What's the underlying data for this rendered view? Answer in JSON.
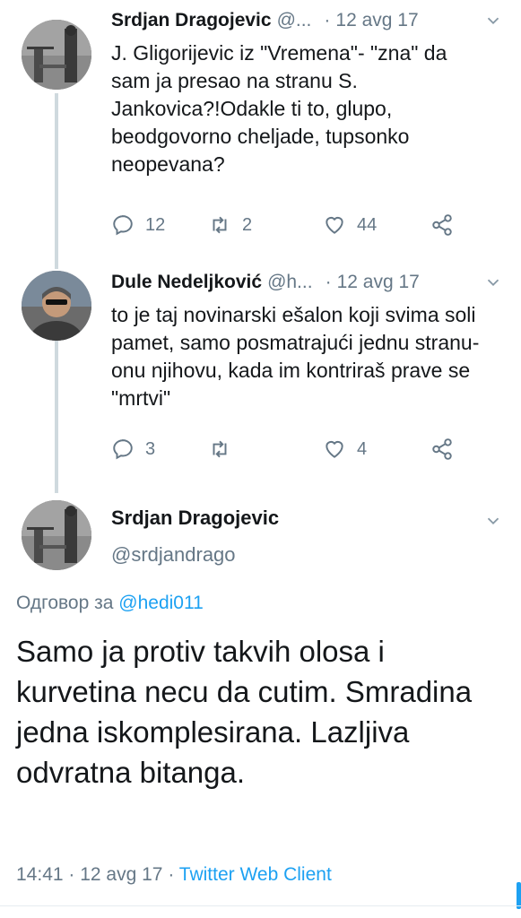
{
  "tweets": [
    {
      "name": "Srdjan Dragojevic",
      "handle": "@...",
      "time": "12 avg 17",
      "text": "J. Gligorijevic iz \"Vremena\"- \"zna\" da sam ja presao na stranu S. Jankovica?!Odakle ti to, glupo, beodgovorno cheljade, tupsonko neopevana?",
      "replies": "12",
      "retweets": "2",
      "likes": "44"
    },
    {
      "name": "Dule Nedeljković",
      "handle": "@h...",
      "time": "12 avg 17",
      "text": "to je taj novinarski ešalon koji svima soli pamet, samo posmatrajući jednu stranu- onu njihovu, kada im kontriraš prave se \"mrtvi\"",
      "replies": "3",
      "retweets": "",
      "likes": "4"
    }
  ],
  "main_tweet": {
    "name": "Srdjan Dragojevic",
    "handle": "@srdjandrago",
    "reply_prefix": "Одговор за",
    "reply_mention": "@hedi011",
    "text": "Samo ja protiv takvih olosa i kurvetina necu da cutim. Smradina jedna iskomplesirana. Lazljiva odvratna bitanga.",
    "time": "14:41",
    "date": "12 avg 17",
    "client": "Twitter Web Client"
  },
  "colors": {
    "accent": "#1da1f2",
    "muted": "#657786",
    "text": "#14171a"
  }
}
